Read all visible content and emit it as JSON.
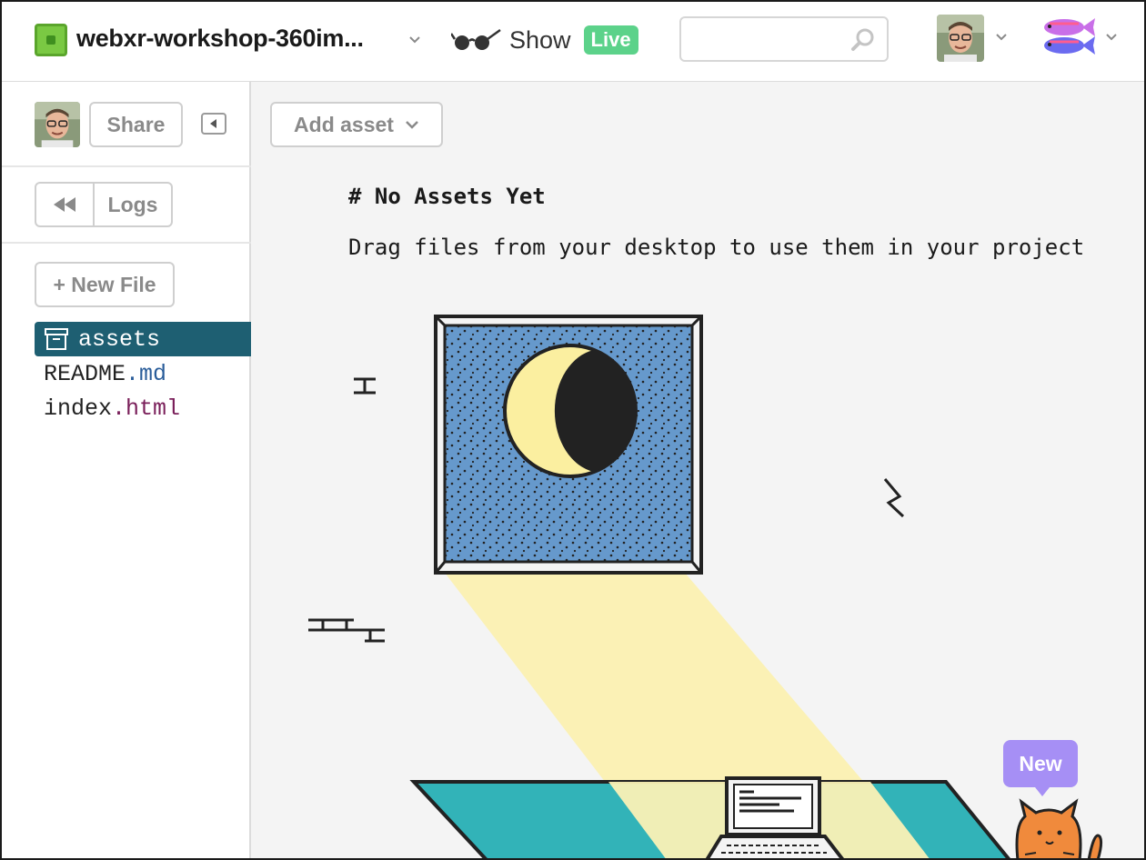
{
  "header": {
    "project_name": "webxr-workshop-360im...",
    "show_label": "Show",
    "live_badge": "Live",
    "search_placeholder": ""
  },
  "sidebar": {
    "share_label": "Share",
    "logs_label": "Logs",
    "new_file_label": "+ New File",
    "files": [
      {
        "name": "assets",
        "base": "assets",
        "ext": ""
      },
      {
        "name": "README.md",
        "base": "README",
        "ext": ".md"
      },
      {
        "name": "index.html",
        "base": "index",
        "ext": ".html"
      }
    ]
  },
  "main": {
    "add_asset_label": "Add asset",
    "title": "# No Assets Yet",
    "description": "Drag files from your desktop to use them in your project",
    "new_badge": "New"
  },
  "colors": {
    "selected_file_bg": "#1e5f72",
    "live_badge": "#5cd28a",
    "new_badge": "#a68ff5",
    "window_blue": "#6699cc",
    "light_beam": "#fbf1b5",
    "rug_teal": "#32b3b8"
  }
}
